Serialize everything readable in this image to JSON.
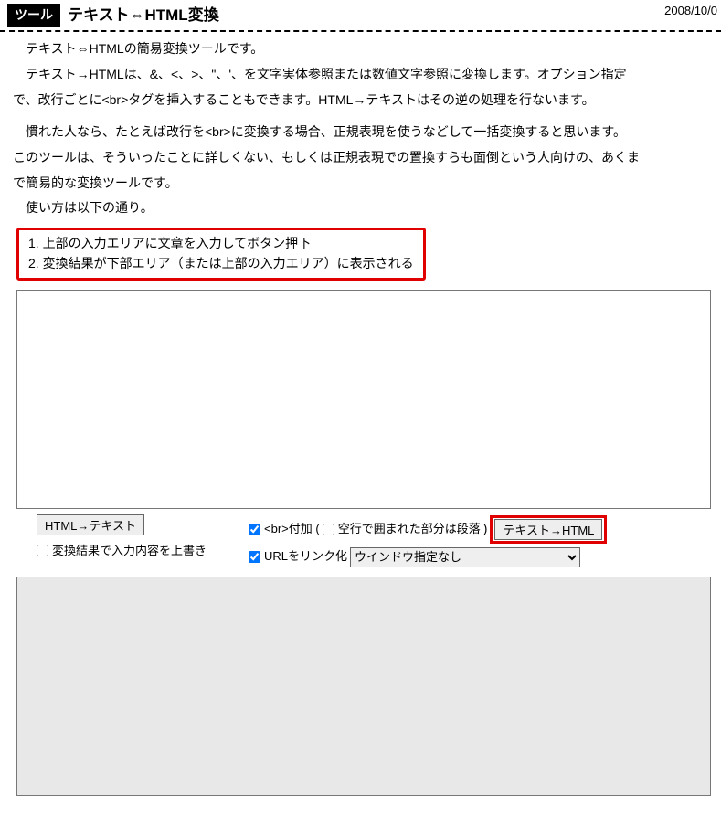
{
  "header": {
    "badge": "ツール",
    "title": "テキスト⇔HTML変換",
    "date": "2008/10/0"
  },
  "intro": {
    "p1": "テキスト⇔HTMLの簡易変換ツールです。",
    "p2a": "テキスト→HTMLは、&、<、>、\"、'、を文字実体参照または数値文字参照に変換します。オプション指定",
    "p2b": "で、改行ごとに<br>タグを挿入することもできます。HTML→テキストはその逆の処理を行ないます。",
    "p3a": "慣れた人なら、たとえば改行を<br>に変換する場合、正規表現を使うなどして一括変換すると思います。",
    "p3b": "このツールは、そういったことに詳しくない、もしくは正規表現での置換すらも面倒という人向けの、あくま",
    "p3c": "で簡易的な変換ツールです。",
    "p4": "使い方は以下の通り。"
  },
  "steps": {
    "s1": "1. 上部の入力エリアに文章を入力してボタン押下",
    "s2": "2. 変換結果が下部エリア（または上部の入力エリア）に表示される"
  },
  "controls": {
    "btn_html_to_text": "HTML→テキスト",
    "cb_overwrite": "変換結果で入力内容を上書き",
    "cb_br": "<br>付加 (",
    "cb_blank_para": "空行で囲まれた部分は段落",
    "close_paren": ")",
    "btn_text_to_html": "テキスト→HTML",
    "cb_linkify": "URLをリンク化",
    "select_window": "ウインドウ指定なし"
  }
}
